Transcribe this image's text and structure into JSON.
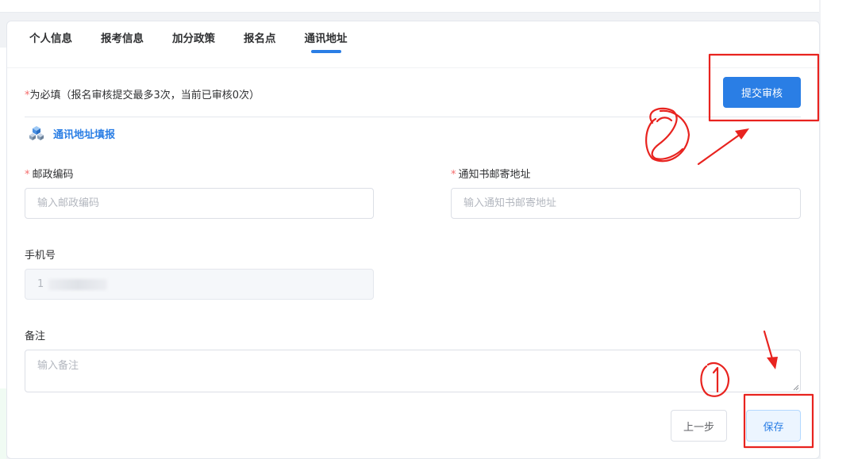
{
  "tabs": [
    {
      "label": "个人信息",
      "active": false
    },
    {
      "label": "报考信息",
      "active": false
    },
    {
      "label": "加分政策",
      "active": false
    },
    {
      "label": "报名点",
      "active": false
    },
    {
      "label": "通讯地址",
      "active": true
    }
  ],
  "required_note": {
    "star": "*",
    "text": "为必填（报名审核提交最多3次，当前已审核0次）"
  },
  "submit_review_label": "提交审核",
  "section_title": "通讯地址填报",
  "fields": {
    "postal_code": {
      "label": "邮政编码",
      "required": true,
      "placeholder": "输入邮政编码",
      "value": ""
    },
    "mail_address": {
      "label": "通知书邮寄地址",
      "required": true,
      "placeholder": "输入通知书邮寄地址",
      "value": ""
    },
    "phone": {
      "label": "手机号",
      "required": false,
      "value": "1",
      "disabled": true
    },
    "remark": {
      "label": "备注",
      "required": false,
      "placeholder": "输入备注",
      "value": ""
    }
  },
  "buttons": {
    "prev_label": "上一步",
    "save_label": "保存"
  },
  "colors": {
    "primary": "#2a7ee5",
    "required": "#f56c6c",
    "annotation": "#e8231f"
  },
  "icons": {
    "section": "cubes-icon",
    "resize": "resize-handle-icon"
  }
}
